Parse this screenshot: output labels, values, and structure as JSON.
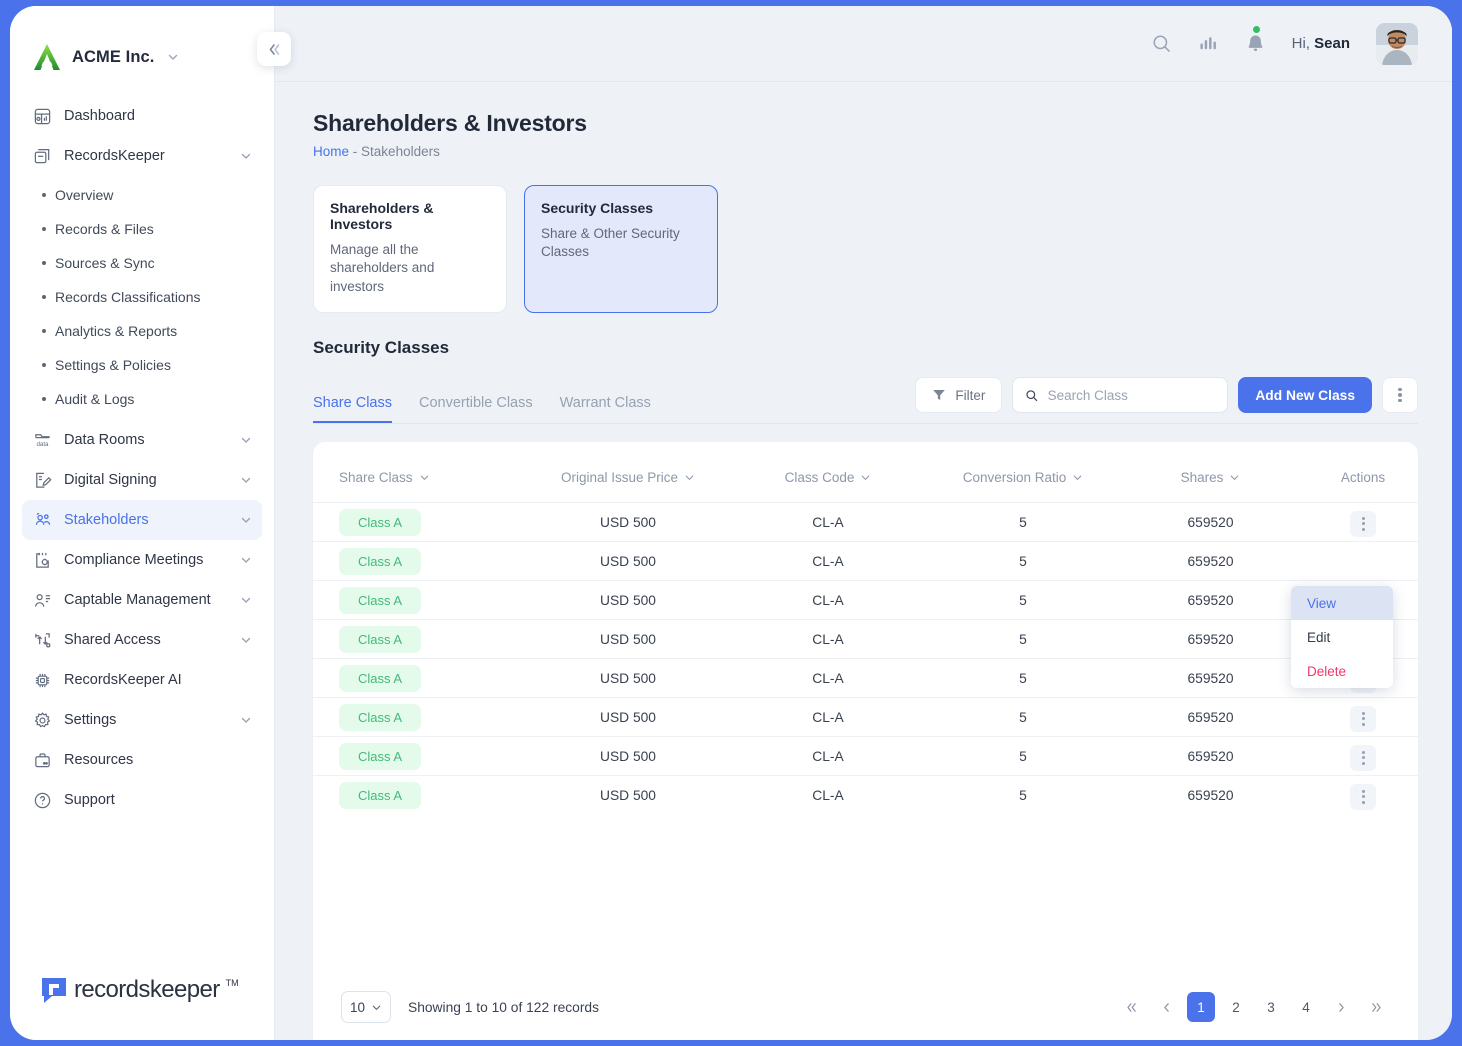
{
  "brand": {
    "name": "ACME Inc.",
    "caret_icon": "chevron-down-icon",
    "logo_icon": "acme-logo-icon"
  },
  "sidebar": {
    "collapse_icon": "double-chevron-left-icon",
    "items": [
      {
        "label": "Dashboard",
        "icon": "dashboard-icon",
        "expandable": false,
        "active": false
      },
      {
        "label": "RecordsKeeper",
        "icon": "records-box-icon",
        "expandable": true,
        "active": false
      },
      {
        "label": "Data Rooms",
        "icon": "data-rooms-icon",
        "expandable": true,
        "active": false
      },
      {
        "label": "Digital Signing",
        "icon": "digital-signing-icon",
        "expandable": true,
        "active": false
      },
      {
        "label": "Stakeholders",
        "icon": "stakeholders-icon",
        "expandable": true,
        "active": true
      },
      {
        "label": "Compliance Meetings",
        "icon": "compliance-meetings-icon",
        "expandable": true,
        "active": false
      },
      {
        "label": "Captable Management",
        "icon": "captable-icon",
        "expandable": true,
        "active": false
      },
      {
        "label": "Shared Access",
        "icon": "shared-access-icon",
        "expandable": true,
        "active": false
      },
      {
        "label": "RecordsKeeper AI",
        "icon": "ai-chip-icon",
        "expandable": false,
        "active": false
      },
      {
        "label": "Settings",
        "icon": "gear-icon",
        "expandable": true,
        "active": false
      },
      {
        "label": "Resources",
        "icon": "briefcase-icon",
        "expandable": false,
        "active": false
      },
      {
        "label": "Support",
        "icon": "question-circle-icon",
        "expandable": false,
        "active": false
      }
    ],
    "recordskeeper_subitems": [
      "Overview",
      "Records & Files",
      "Sources & Sync",
      "Records Classifications",
      "Analytics & Reports",
      "Settings & Policies",
      "Audit & Logs"
    ],
    "footer_logo": {
      "word": "recordskeeper",
      "tm": "TM"
    }
  },
  "topbar": {
    "search_icon": "search-icon",
    "analytics_icon": "bar-chart-icon",
    "bell_icon": "bell-icon",
    "has_notification_dot": true,
    "greeting_prefix": "Hi, ",
    "user_name": "Sean",
    "avatar_icon": "avatar"
  },
  "page": {
    "title": "Shareholders & Investors",
    "breadcrumb_home": "Home",
    "breadcrumb_sep": "-",
    "breadcrumb_current": "Stakeholders"
  },
  "cards": [
    {
      "title": "Shareholders & Investors",
      "subtitle": "Manage all the shareholders and investors",
      "selected": false
    },
    {
      "title": "Security Classes",
      "subtitle": "Share & Other Security Classes",
      "selected": true
    }
  ],
  "section": {
    "title": "Security Classes"
  },
  "tabs": [
    {
      "label": "Share Class",
      "active": true
    },
    {
      "label": "Convertible Class",
      "active": false
    },
    {
      "label": "Warrant Class",
      "active": false
    }
  ],
  "toolbar": {
    "filter_label": "Filter",
    "filter_icon": "funnel-icon",
    "search_placeholder": "Search Class",
    "search_value": "",
    "search_icon": "search-icon",
    "add_label": "Add New Class",
    "kebab_icon": "kebab-vertical-icon",
    "accent_color": "#4a72ea"
  },
  "table": {
    "columns": [
      {
        "label": "Share Class",
        "sortable": true
      },
      {
        "label": "Original Issue Price",
        "sortable": true
      },
      {
        "label": "Class Code",
        "sortable": true
      },
      {
        "label": "Conversion Ratio",
        "sortable": true
      },
      {
        "label": "Shares",
        "sortable": true
      },
      {
        "label": "Actions",
        "sortable": false
      }
    ],
    "rows": [
      {
        "share_class": "Class A",
        "original_issue_price": "USD 500",
        "class_code": "CL-A",
        "conversion_ratio": "5",
        "shares": "659520"
      },
      {
        "share_class": "Class A",
        "original_issue_price": "USD 500",
        "class_code": "CL-A",
        "conversion_ratio": "5",
        "shares": "659520"
      },
      {
        "share_class": "Class A",
        "original_issue_price": "USD 500",
        "class_code": "CL-A",
        "conversion_ratio": "5",
        "shares": "659520"
      },
      {
        "share_class": "Class A",
        "original_issue_price": "USD 500",
        "class_code": "CL-A",
        "conversion_ratio": "5",
        "shares": "659520"
      },
      {
        "share_class": "Class A",
        "original_issue_price": "USD 500",
        "class_code": "CL-A",
        "conversion_ratio": "5",
        "shares": "659520"
      },
      {
        "share_class": "Class A",
        "original_issue_price": "USD 500",
        "class_code": "CL-A",
        "conversion_ratio": "5",
        "shares": "659520"
      },
      {
        "share_class": "Class A",
        "original_issue_price": "USD 500",
        "class_code": "CL-A",
        "conversion_ratio": "5",
        "shares": "659520"
      },
      {
        "share_class": "Class A",
        "original_issue_price": "USD 500",
        "class_code": "CL-A",
        "conversion_ratio": "5",
        "shares": "659520"
      }
    ],
    "pill_bg": "#e4fbec",
    "pill_color": "#43b97a"
  },
  "row_menu": {
    "visible": true,
    "items": [
      {
        "label": "View",
        "highlighted": true,
        "danger": false
      },
      {
        "label": "Edit",
        "highlighted": false,
        "danger": false
      },
      {
        "label": "Delete",
        "highlighted": false,
        "danger": true
      }
    ],
    "danger_color": "#f0386b"
  },
  "footer": {
    "page_size": "10",
    "showing_text": "Showing 1 to 10 of 122 records",
    "pages": [
      "1",
      "2",
      "3",
      "4"
    ],
    "current_page": "1",
    "first_icon": "double-chevron-left-icon",
    "prev_icon": "chevron-left-icon",
    "next_icon": "chevron-right-icon",
    "last_icon": "double-chevron-right-icon"
  }
}
